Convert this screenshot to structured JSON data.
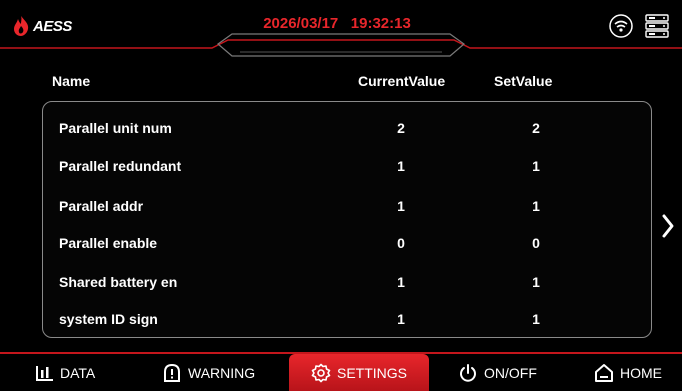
{
  "header": {
    "brand": "AESS",
    "datetime": "2026/03/17   19:32:13",
    "wifi_icon": "wifi-icon",
    "server_icon": "server-icon"
  },
  "table": {
    "columns": {
      "name": "Name",
      "current": "CurrentValue",
      "set": "SetValue"
    },
    "rows": [
      {
        "name": "Parallel unit num",
        "current": "2",
        "set": "2"
      },
      {
        "name": "Parallel redundant",
        "current": "1",
        "set": "1"
      },
      {
        "name": "Parallel addr",
        "current": "1",
        "set": "1"
      },
      {
        "name": "Parallel enable",
        "current": "0",
        "set": "0"
      },
      {
        "name": "Shared battery en",
        "current": "1",
        "set": "1"
      },
      {
        "name": "system ID sign",
        "current": "1",
        "set": "1"
      }
    ]
  },
  "nav": {
    "data": "DATA",
    "warning": "WARNING",
    "settings": "SETTINGS",
    "onoff": "ON/OFF",
    "home": "HOME",
    "active": "settings"
  },
  "colors": {
    "accent": "#e8262b",
    "panel_border": "#8a8a8a",
    "background": "#000000"
  }
}
